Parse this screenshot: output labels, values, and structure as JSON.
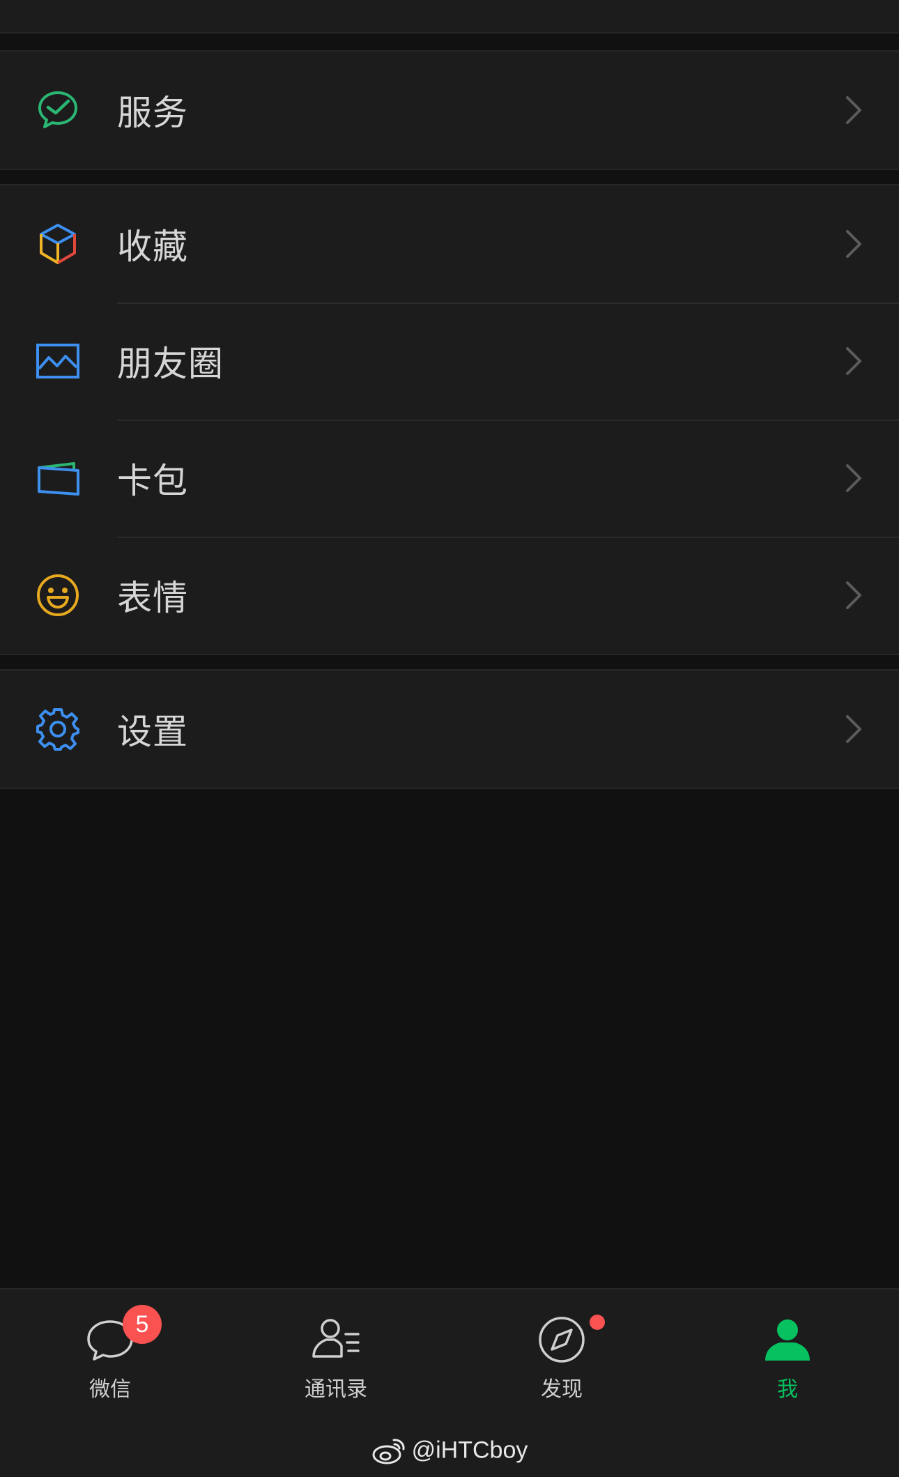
{
  "colors": {
    "background": "#111111",
    "card": "#1c1c1c",
    "text": "#d6d6d6",
    "accent_green": "#07c160",
    "badge_red": "#fa5151"
  },
  "menu": {
    "services": {
      "label": "服务",
      "icon": "wechat-pay-icon"
    },
    "favorites": {
      "label": "收藏",
      "icon": "cube-icon"
    },
    "moments": {
      "label": "朋友圈",
      "icon": "image-icon"
    },
    "cards": {
      "label": "卡包",
      "icon": "wallet-card-icon"
    },
    "stickers": {
      "label": "表情",
      "icon": "smiley-icon"
    },
    "settings": {
      "label": "设置",
      "icon": "gear-icon"
    }
  },
  "tabbar": {
    "chats": {
      "label": "微信",
      "icon": "chat-bubble-icon",
      "badge": "5"
    },
    "contacts": {
      "label": "通讯录",
      "icon": "contacts-icon"
    },
    "discover": {
      "label": "发现",
      "icon": "compass-icon",
      "dot": true
    },
    "me": {
      "label": "我",
      "icon": "person-icon",
      "active": true
    }
  },
  "watermark": {
    "text": "@iHTCboy",
    "icon": "weibo-icon"
  }
}
